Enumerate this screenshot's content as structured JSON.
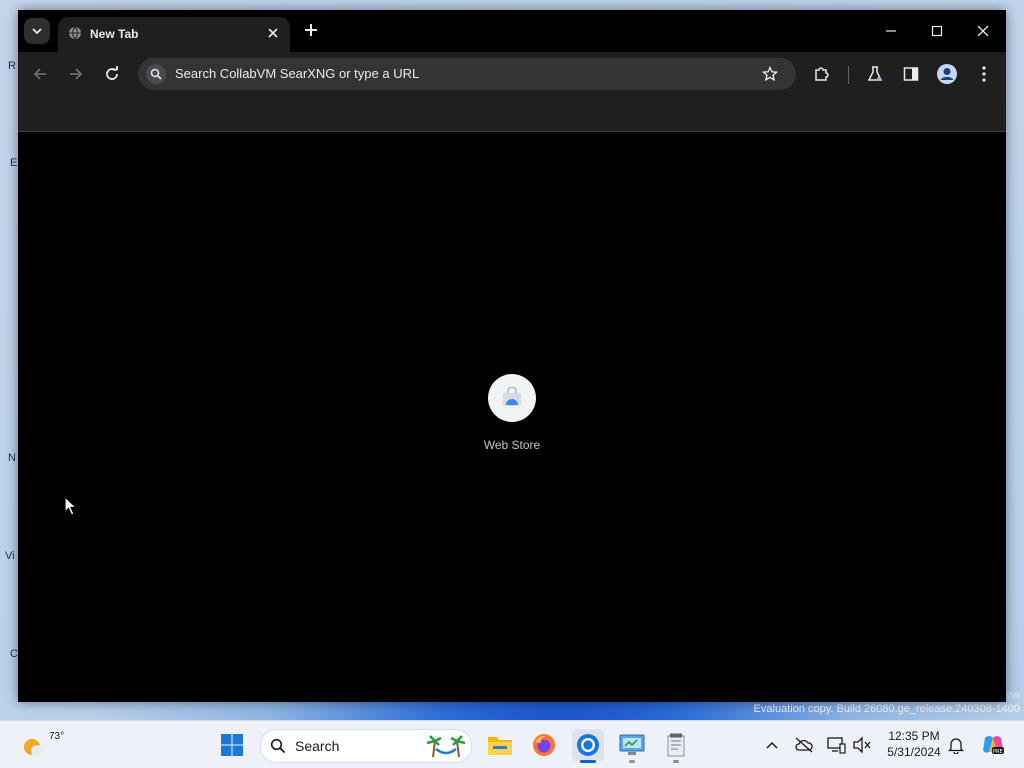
{
  "browser": {
    "tab": {
      "title": "New Tab"
    },
    "omnibox": {
      "placeholder": "Search CollabVM SearXNG or type a URL"
    },
    "shortcuts": [
      {
        "label": "Web Store"
      }
    ],
    "icons": {
      "tab_search": "chevron-down-icon",
      "favicon": "globe-icon",
      "close_tab": "close-icon",
      "new_tab": "plus-icon",
      "minimize": "minimize-icon",
      "maximize": "maximize-icon",
      "close_window": "close-icon",
      "back": "arrow-left-icon",
      "forward": "arrow-right-icon",
      "reload": "reload-icon",
      "search": "search-icon",
      "bookmark": "star-icon",
      "extensions": "puzzle-icon",
      "labs": "flask-icon",
      "side_panel": "side-panel-icon",
      "profile": "avatar-icon",
      "menu": "kebab-menu-icon"
    },
    "colors": {
      "frame": "#000000",
      "toolbar": "#1f1f1f",
      "omnibox": "#333436",
      "text": "#e8eaed"
    }
  },
  "desktop": {
    "watermark_line1": "ew",
    "watermark_line2": "Evaluation copy. Build 26080.ge_release.240308-1400",
    "left_edge_fragments": [
      "R",
      "E",
      "N",
      "Vi",
      "C"
    ]
  },
  "taskbar": {
    "weather_temp": "73°",
    "search_label": "Search",
    "clock_time": "12:35 PM",
    "clock_date": "5/31/2024",
    "pinned_apps": [
      "start",
      "search",
      "file-explorer",
      "firefox",
      "chrome",
      "control-panel",
      "notepad"
    ],
    "colors": {
      "background": "#eef1f7",
      "accent": "#0067c0"
    }
  }
}
